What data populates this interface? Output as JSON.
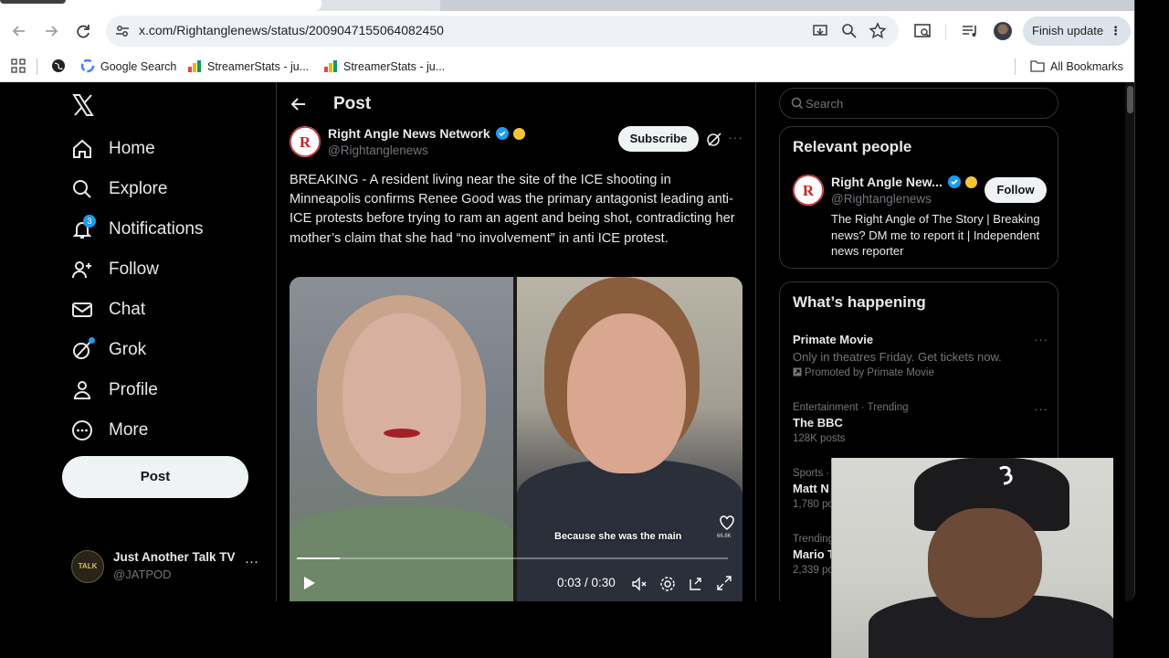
{
  "browser": {
    "url": "x.com/Rightanglenews/status/2009047155064082450",
    "finish_update": "Finish update",
    "bookmarks": [
      {
        "label": "Google Search"
      },
      {
        "label": "StreamerStats - ju..."
      },
      {
        "label": "StreamerStats - ju..."
      }
    ],
    "all_bookmarks": "All Bookmarks"
  },
  "nav": {
    "items": [
      {
        "label": "Home"
      },
      {
        "label": "Explore"
      },
      {
        "label": "Notifications",
        "badge": "3"
      },
      {
        "label": "Follow"
      },
      {
        "label": "Chat"
      },
      {
        "label": "Grok"
      },
      {
        "label": "Profile"
      },
      {
        "label": "More"
      }
    ],
    "post_button": "Post",
    "account": {
      "name": "Just Another Talk TV",
      "handle": "@JATPOD",
      "avatar_text": "TALK"
    }
  },
  "post": {
    "header": "Post",
    "author": {
      "name": "Right Angle News Network",
      "handle": "@Rightanglenews"
    },
    "subscribe": "Subscribe",
    "text": "BREAKING - A resident living near the site of the ICE shooting in Minneapolis confirms Renee Good was the primary antagonist leading anti-ICE protests before trying to ram an agent and being shot, contradicting her mother’s claim that she had “no involvement” in anti ICE protest.",
    "video": {
      "caption": "Because she was the main",
      "time": "0:03 / 0:30",
      "progress": 0.1,
      "like_count": "66.8K"
    }
  },
  "sidebar": {
    "search_placeholder": "Search",
    "relevant_title": "Relevant people",
    "person": {
      "name": "Right Angle New...",
      "handle": "@Rightanglenews",
      "follow": "Follow",
      "bio": "The Right Angle of The Story | Breaking news? DM me to report it | Independent news reporter"
    },
    "happening_title": "What’s happening",
    "trends": [
      {
        "meta": "",
        "name": "Primate Movie",
        "sub": "Only in theatres Friday. Get tickets now.",
        "promo": "Promoted by Primate Movie"
      },
      {
        "meta": "Entertainment · Trending",
        "name": "The BBC",
        "sub": "128K posts"
      },
      {
        "meta": "Sports ·",
        "name": "Matt N",
        "sub": "1,780 po"
      },
      {
        "meta": "Trending",
        "name": "Mario T",
        "sub": "2,339 pc"
      }
    ]
  },
  "colors": {
    "accent": "#1d9bf0",
    "gold": "#f4c534",
    "background": "#000000"
  }
}
